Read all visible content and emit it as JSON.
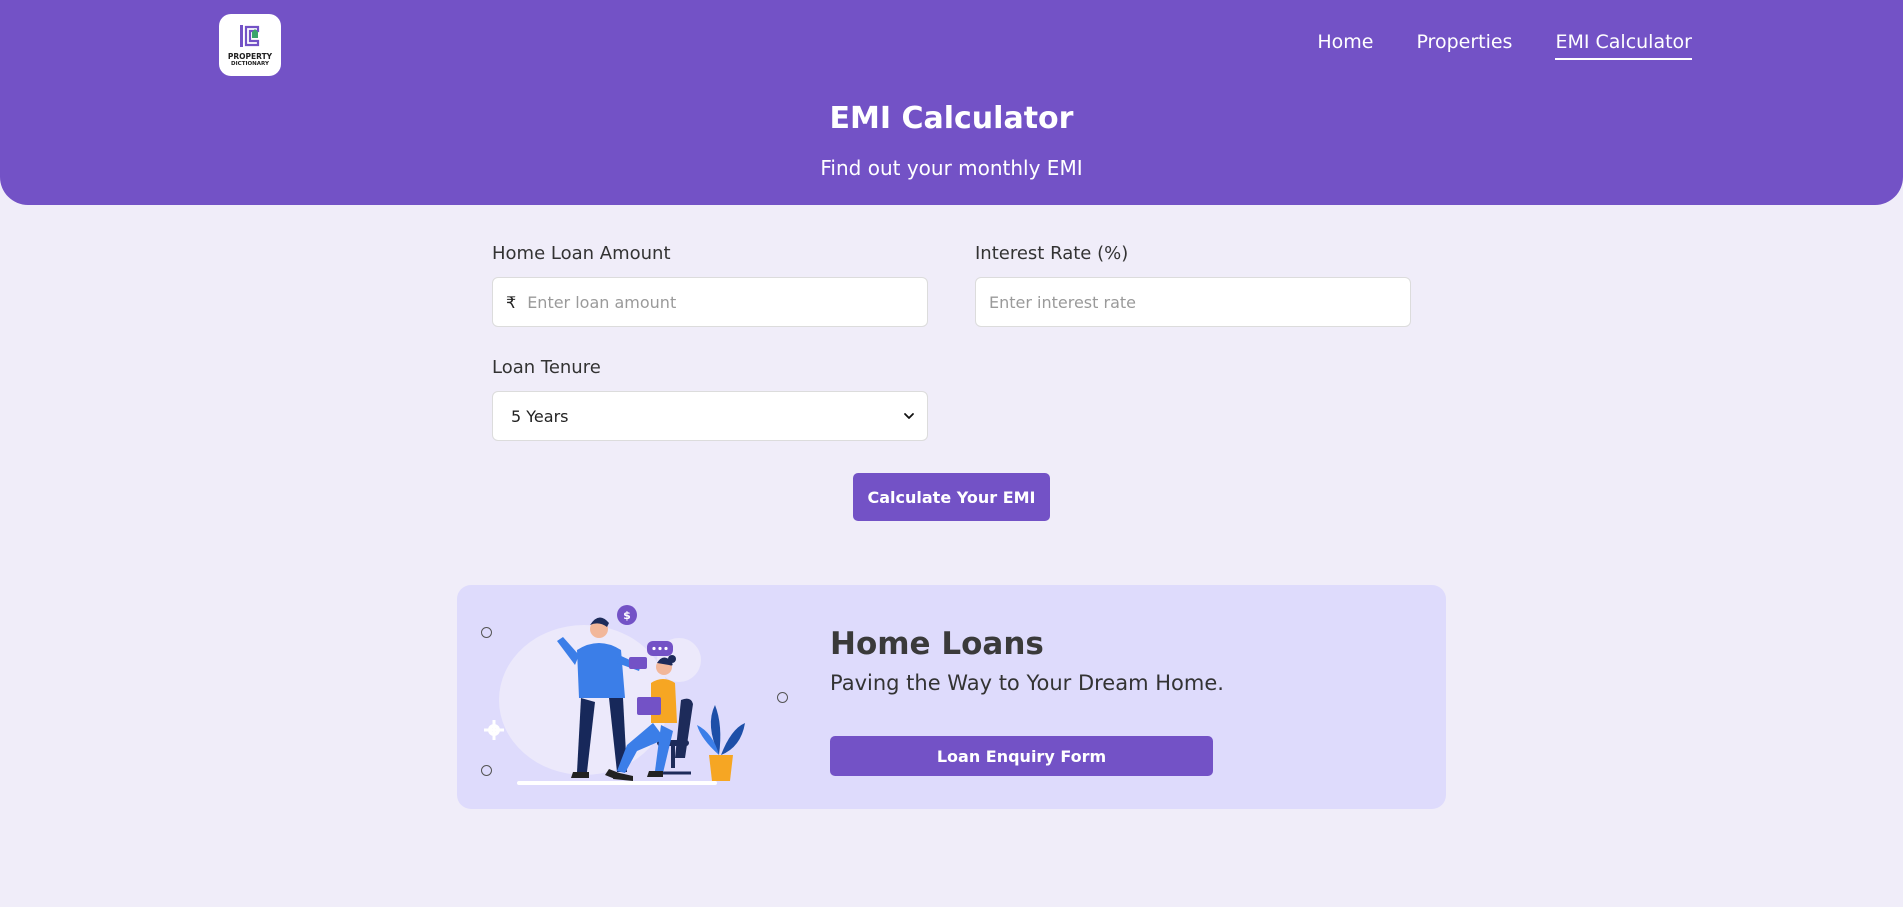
{
  "brand": {
    "logo_line1": "PROPERTY",
    "logo_line2": "DICTIONARY"
  },
  "nav": {
    "items": [
      {
        "label": "Home"
      },
      {
        "label": "Properties"
      },
      {
        "label": "EMI Calculator",
        "active": true
      }
    ]
  },
  "hero": {
    "title": "EMI Calculator",
    "subtitle": "Find out your monthly EMI"
  },
  "form": {
    "loan_amount": {
      "label": "Home Loan Amount",
      "currency_symbol": "₹",
      "placeholder": "Enter loan amount",
      "value": ""
    },
    "interest_rate": {
      "label": "Interest Rate (%)",
      "placeholder": "Enter interest rate",
      "value": ""
    },
    "tenure": {
      "label": "Loan Tenure",
      "selected": "5 Years"
    },
    "submit_label": "Calculate Your EMI"
  },
  "loan_card": {
    "title": "Home Loans",
    "subtitle": "Paving the Way to Your Dream Home.",
    "button_label": "Loan Enquiry Form"
  },
  "colors": {
    "primary": "#7352c6",
    "page_background": "#f0edf9",
    "card_background": "#dedbfc"
  }
}
